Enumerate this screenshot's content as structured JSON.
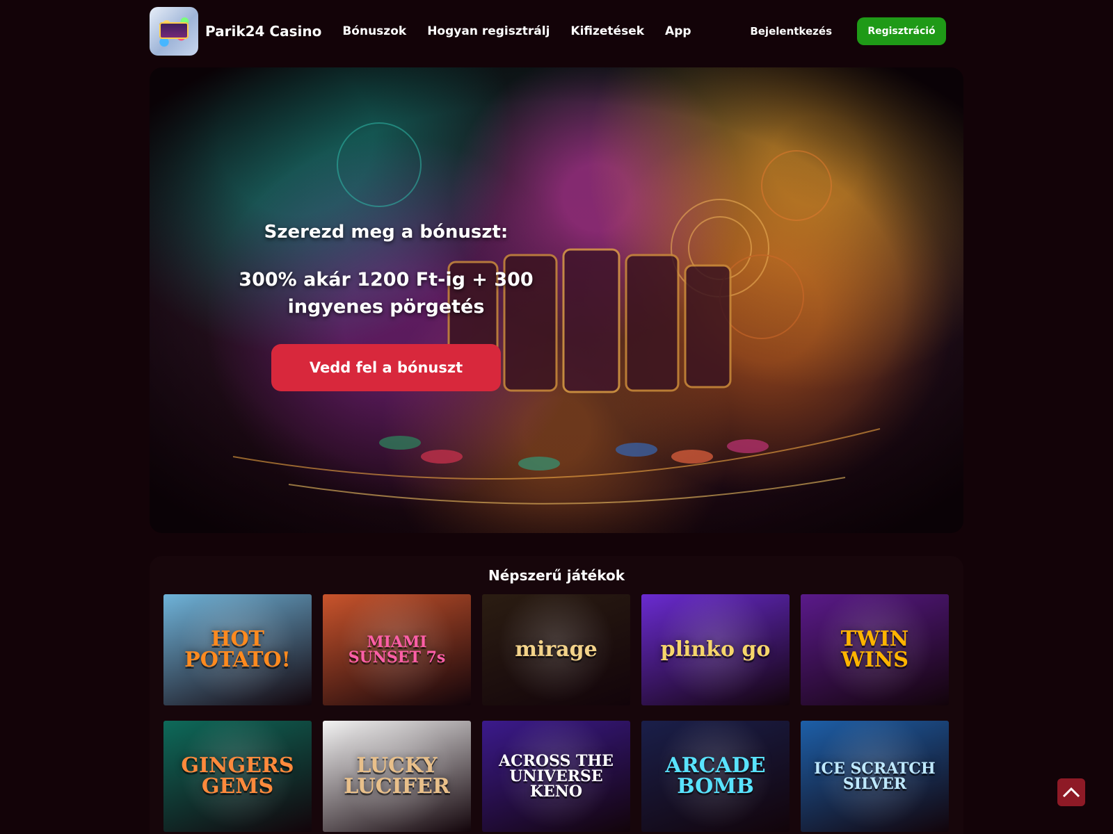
{
  "header": {
    "brand": "Parik24 Casino",
    "nav": [
      "Bónuszok",
      "Hogyan regisztrálj",
      "Kifizetések",
      "App"
    ],
    "login_label": "Bejelentkezés",
    "register_label": "Regisztráció"
  },
  "hero": {
    "title": "Szerezd meg a bónuszt:",
    "offer": "300% akár 1200 Ft-ig + 300 ingyenes pörgetés",
    "cta_label": "Vedd fel a bónuszt"
  },
  "games": {
    "title": "Népszerű játékok",
    "items": [
      {
        "name": "HOT POTATO!",
        "color": "#ff8a1f",
        "bg": "#6fb3d9"
      },
      {
        "name": "MIAMI SUNSET 7s",
        "color": "#ff5fa8",
        "bg": "#c9542c"
      },
      {
        "name": "mirage",
        "color": "#f3d38a",
        "bg": "#2b1d12"
      },
      {
        "name": "plinko go",
        "color": "#f6d66b",
        "bg": "#6a2bd1"
      },
      {
        "name": "TWIN WINS",
        "color": "#ffb400",
        "bg": "#5a1a8a"
      },
      {
        "name": "GINGERS GEMS",
        "color": "#ff8a3c",
        "bg": "#0e6a5a"
      },
      {
        "name": "LUCKY LUCIFER",
        "color": "#e9c08a",
        "bg": "#f3f3f3"
      },
      {
        "name": "ACROSS THE UNIVERSE KENO",
        "color": "#ffffff",
        "bg": "#3b1a8c"
      },
      {
        "name": "ARCADE BOMB",
        "color": "#59e3ff",
        "bg": "#1a1f4a"
      },
      {
        "name": "ICE SCRATCH SILVER",
        "color": "#bfe9ff",
        "bg": "#1d5fa8"
      }
    ]
  },
  "colors": {
    "accent_red": "#d8283c",
    "register_green": "#1f9a17",
    "page_bg": "#130308"
  },
  "icons": {
    "back_to_top": "chevron-up-icon"
  }
}
